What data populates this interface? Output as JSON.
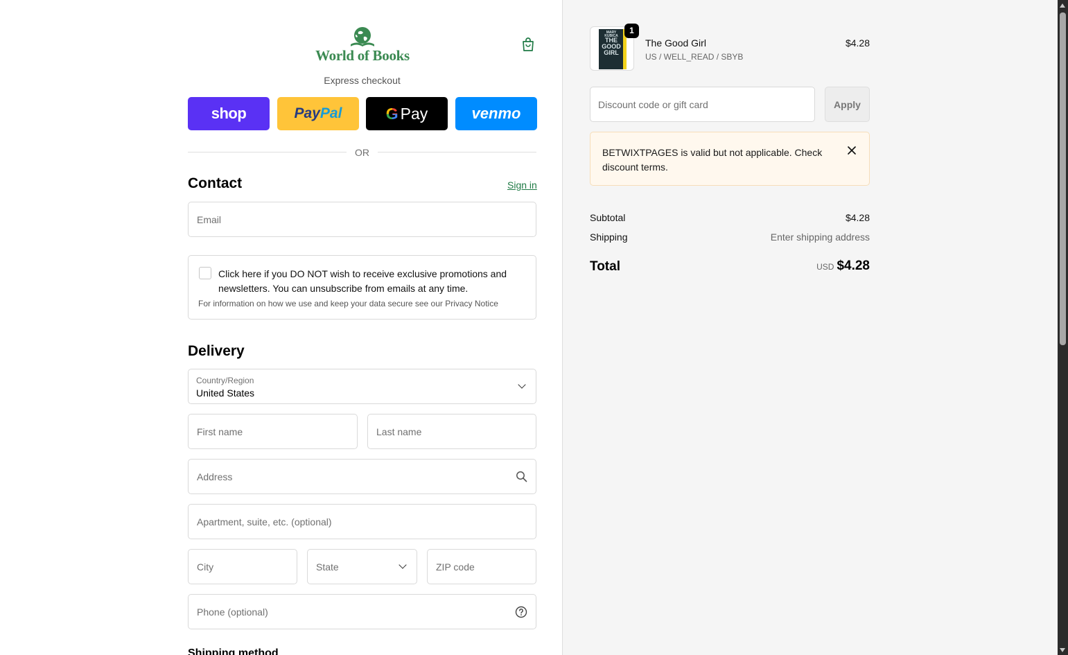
{
  "header": {
    "brand": "World of Books",
    "express_label": "Express checkout"
  },
  "express_buttons": {
    "shop": "shop",
    "paypal_a": "Pay",
    "paypal_b": "Pal",
    "gpay_g": "G",
    "gpay_text": "Pay",
    "venmo": "venmo"
  },
  "or_text": "OR",
  "contact": {
    "title": "Contact",
    "signin": "Sign in",
    "email_placeholder": "Email",
    "newsletter": "Click here if you DO NOT wish to receive exclusive promotions and newsletters. You can unsubscribe from emails at any time.",
    "privacy": "For information on how we use and keep your data secure see our Privacy Notice"
  },
  "delivery": {
    "title": "Delivery",
    "country_label": "Country/Region",
    "country_value": "United States",
    "first_name": "First name",
    "last_name": "Last name",
    "address": "Address",
    "apartment": "Apartment, suite, etc. (optional)",
    "city": "City",
    "state": "State",
    "zip": "ZIP code",
    "phone": "Phone (optional)"
  },
  "shipping_method_title": "Shipping method",
  "cart": {
    "quantity": "1",
    "product_name": "The Good Girl",
    "variant": "US / WELL_READ / SBYB",
    "price": "$4.28",
    "cover_author": "MARY KUBICA",
    "cover_title_1": "THE",
    "cover_title_2": "GOOD",
    "cover_title_3": "GIRL"
  },
  "discount": {
    "placeholder": "Discount code or gift card",
    "apply": "Apply",
    "notice": "BETWIXTPAGES is valid but not applicable. Check discount terms."
  },
  "summary": {
    "subtotal_label": "Subtotal",
    "subtotal_value": "$4.28",
    "shipping_label": "Shipping",
    "shipping_value": "Enter shipping address",
    "total_label": "Total",
    "currency": "USD",
    "total_value": "$4.28"
  },
  "colors": {
    "brand_green": "#3b8a52",
    "shop_purple": "#5a31f4",
    "paypal_yellow": "#ffc439",
    "venmo_blue": "#008cff",
    "notice_bg": "#fff8ee"
  }
}
